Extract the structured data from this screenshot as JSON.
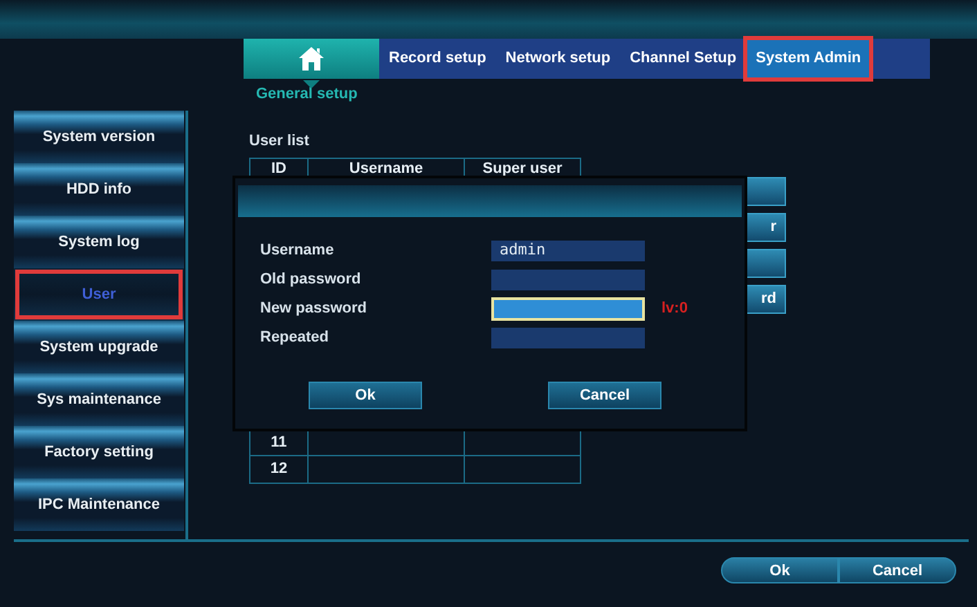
{
  "top_tabs": [
    {
      "kind": "home",
      "selected": false,
      "outlined": false
    },
    {
      "kind": "text",
      "label": "Record setup",
      "selected": false,
      "outlined": false
    },
    {
      "kind": "text",
      "label": "Network setup",
      "selected": false,
      "outlined": false
    },
    {
      "kind": "text",
      "label": "Channel Setup",
      "selected": false,
      "outlined": false
    },
    {
      "kind": "text",
      "label": "System Admin",
      "selected": true,
      "outlined": true
    }
  ],
  "sub_tab": {
    "label": "General setup"
  },
  "sidebar": {
    "items": [
      {
        "label": "System version",
        "selected": false,
        "outlined": false
      },
      {
        "label": "HDD info",
        "selected": false,
        "outlined": false
      },
      {
        "label": "System log",
        "selected": false,
        "outlined": false
      },
      {
        "label": "User",
        "selected": true,
        "outlined": true
      },
      {
        "label": "System upgrade",
        "selected": false,
        "outlined": false
      },
      {
        "label": "Sys maintenance",
        "selected": false,
        "outlined": false
      },
      {
        "label": "Factory setting",
        "selected": false,
        "outlined": false
      },
      {
        "label": "IPC Maintenance",
        "selected": false,
        "outlined": false
      }
    ]
  },
  "user_list": {
    "title": "User list",
    "columns": [
      "ID",
      "Username",
      "Super user"
    ],
    "rows": [
      {
        "id": "11"
      },
      {
        "id": "12"
      }
    ]
  },
  "side_buttons": [
    {
      "kind": "blank"
    },
    {
      "kind": "label",
      "label": "r"
    },
    {
      "kind": "blank"
    },
    {
      "kind": "label",
      "label": "rd"
    }
  ],
  "dialog": {
    "fields": [
      {
        "label": "Username",
        "value": "admin",
        "focused": false
      },
      {
        "label": "Old password",
        "focused": false
      },
      {
        "label": "New password",
        "focused": true,
        "strength": "lv:0"
      },
      {
        "label": "Repeated",
        "focused": false
      }
    ],
    "buttons": [
      "Ok",
      "Cancel"
    ]
  },
  "footer_buttons": [
    "Ok",
    "Cancel"
  ]
}
